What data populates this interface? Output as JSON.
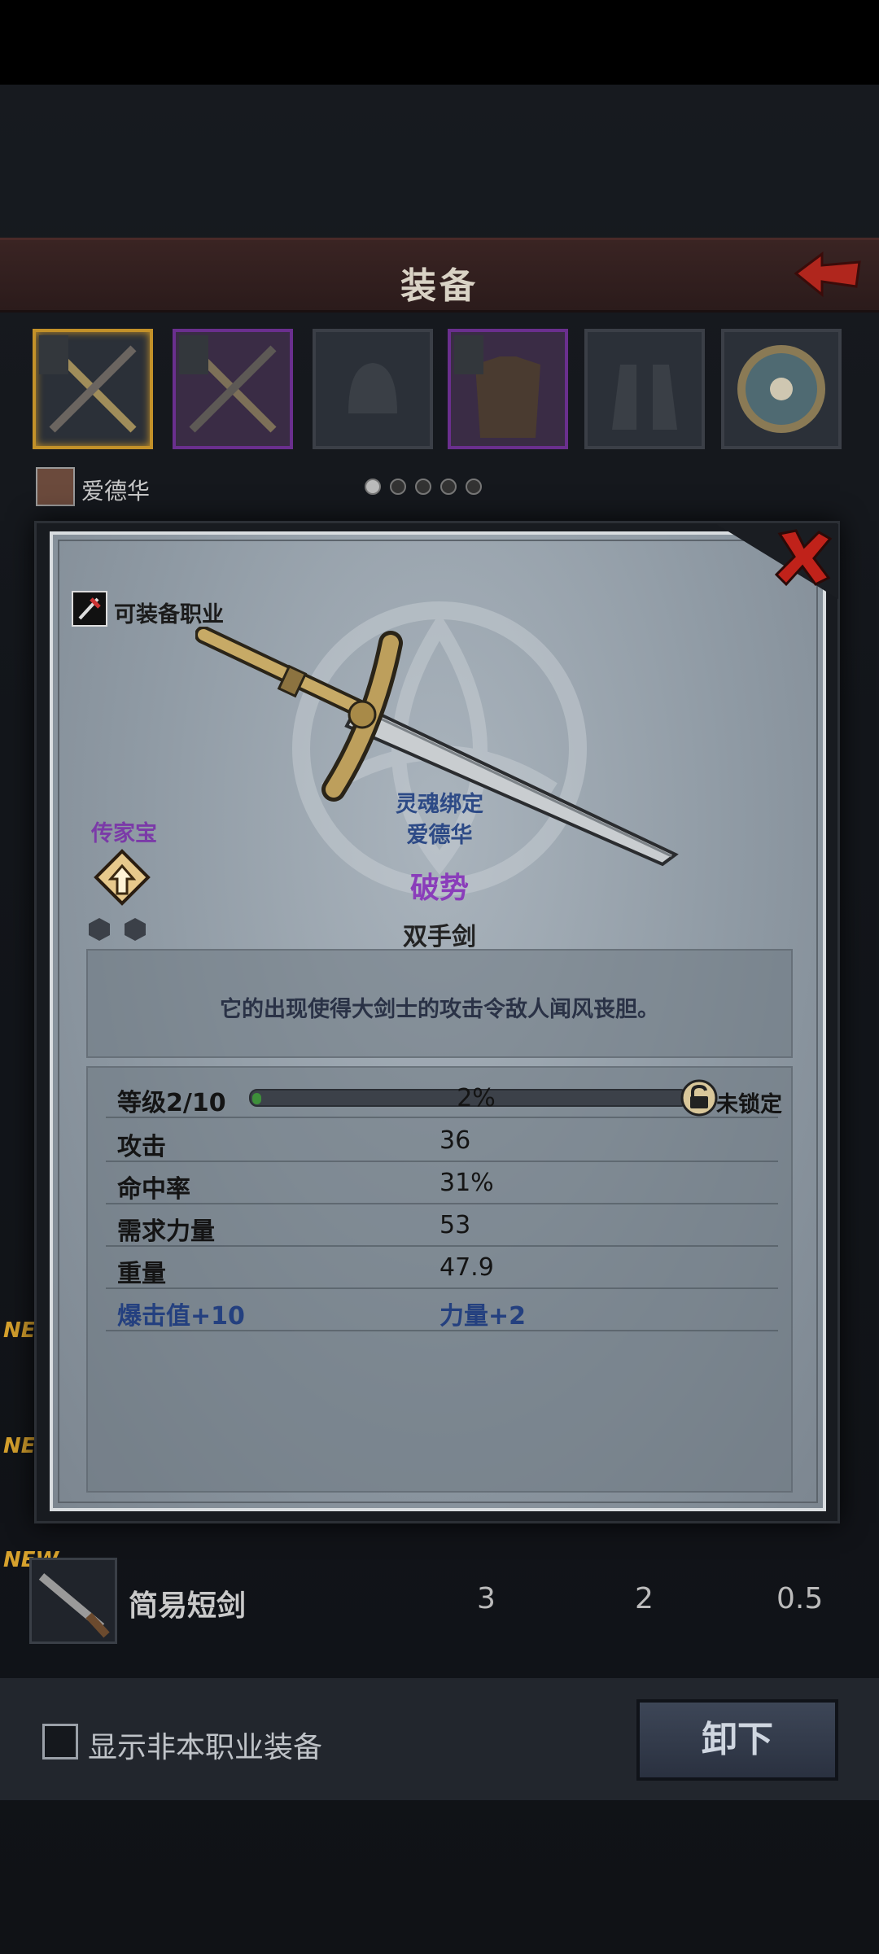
{
  "header": {
    "title": "装备"
  },
  "owner": {
    "name": "爱德华"
  },
  "list": {
    "new_tag": "NEW",
    "item": {
      "name": "简易短剑",
      "v1": "3",
      "v2": "2",
      "v3": "0.5"
    }
  },
  "footer": {
    "checkbox_label": "显示非本职业装备",
    "unequip_label": "卸下"
  },
  "modal": {
    "class_label": "可装备职业",
    "rarity_label": "传家宝",
    "soulbound_line1": "灵魂绑定",
    "soulbound_line2": "爱德华",
    "item_name": "破势",
    "item_type": "双手剑",
    "description": "它的出现使得大剑士的攻击令敌人闻风丧胆。",
    "level": {
      "label": "等级2/10",
      "progress_pct": 2,
      "progress_text": "2%",
      "lock_text": "未锁定"
    },
    "stats": [
      {
        "label": "攻击",
        "value": "36"
      },
      {
        "label": "命中率",
        "value": "31%"
      },
      {
        "label": "需求力量",
        "value": "53"
      },
      {
        "label": "重量",
        "value": "47.9"
      }
    ],
    "bonuses": {
      "left": "爆击值+10",
      "right": "力量+2"
    }
  },
  "colors": {
    "rarity": "#7b3aa8",
    "soulbound": "#2d4a86",
    "close": "#c0221a",
    "selected_slot": "#c39129"
  },
  "icons": [
    "back-arrow-icon",
    "close-icon",
    "lock-icon",
    "heirloom-icon",
    "class-icon",
    "sword-icon"
  ]
}
